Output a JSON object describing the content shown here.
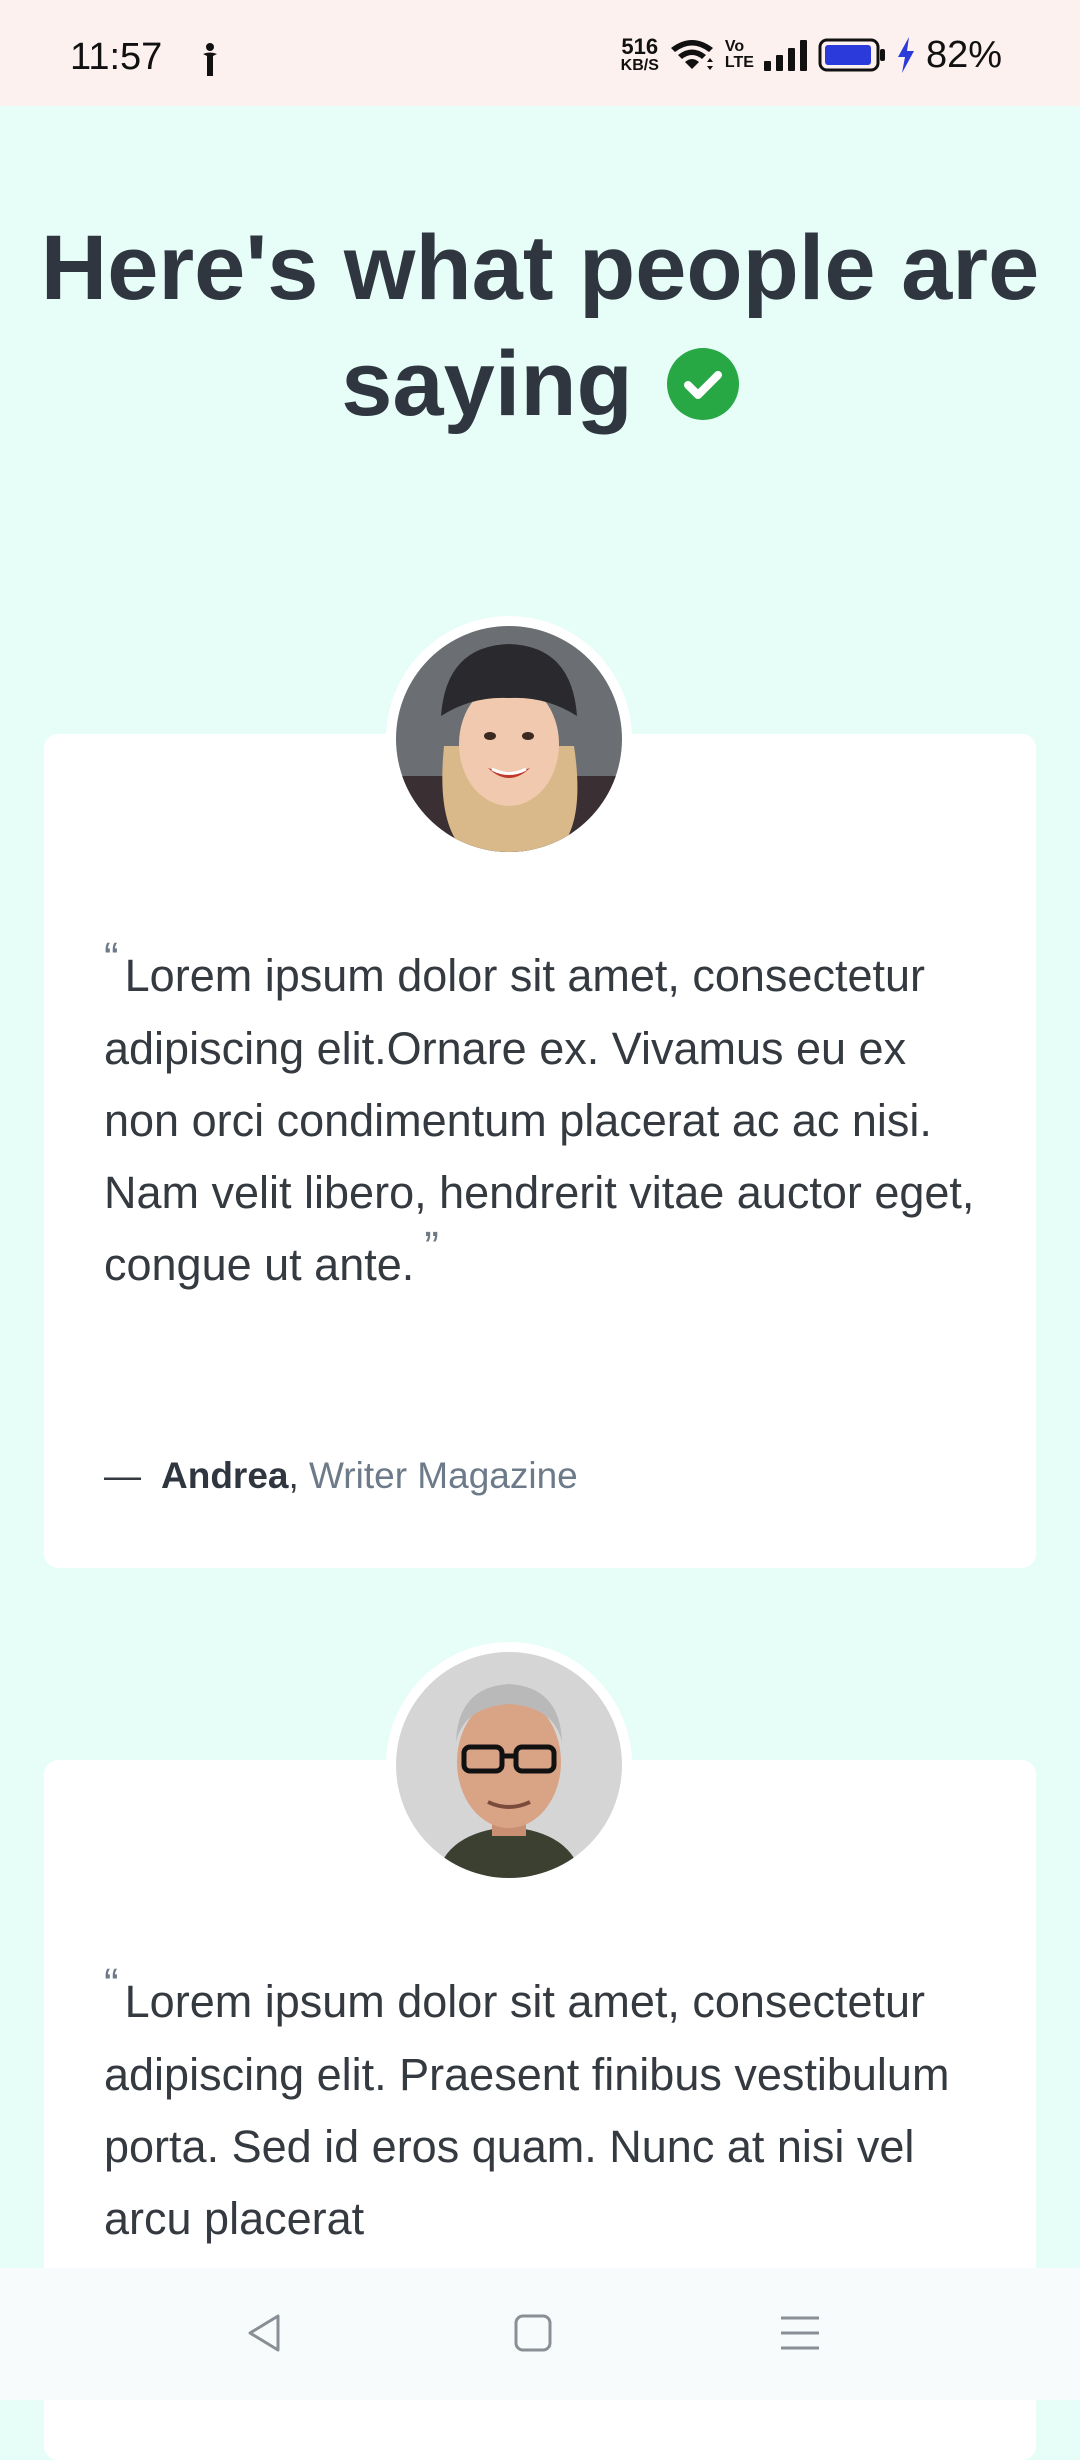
{
  "status_bar": {
    "time": "11:57",
    "net_speed_value": "516",
    "net_speed_unit": "KB/S",
    "volte_top": "Vo",
    "volte_bottom": "LTE",
    "battery_percent": "82%"
  },
  "header": {
    "title_line1": "Here's what people are",
    "title_line2": "saying"
  },
  "testimonials": [
    {
      "open_quote": "“",
      "text": "Lorem ipsum dolor sit amet, consectetur adipiscing elit.Ornare ex. Vivamus eu ex non orci condimentum placerat ac ac nisi. Nam velit libero, hendrerit vitae auctor eget, congue ut ante.",
      "close_quote": "”",
      "dash": "—",
      "author": "Andrea",
      "separator": ",",
      "company": "Writer Magazine"
    },
    {
      "open_quote": "“",
      "text": "Lorem ipsum dolor sit amet, consectetur adipiscing elit. Praesent finibus vestibulum porta. Sed id eros quam. Nunc at nisi vel arcu placerat"
    }
  ],
  "colors": {
    "page_background": "#e6fdf8",
    "status_bar_background": "#fdf1ef",
    "check_icon": "#28a745",
    "title_text": "#2f3640",
    "muted_text": "#6c7a89",
    "battery_fill": "#2b3adb",
    "charging_bolt": "#2b3adb"
  },
  "icons": {
    "status_notification": "notification-icon",
    "wifi": "wifi-icon",
    "signal": "signal-icon",
    "battery": "battery-icon",
    "charging": "charging-bolt-icon",
    "title_badge": "check-circle-icon",
    "nav_back": "back-triangle-icon",
    "nav_home": "home-square-icon",
    "nav_recent": "menu-lines-icon"
  }
}
